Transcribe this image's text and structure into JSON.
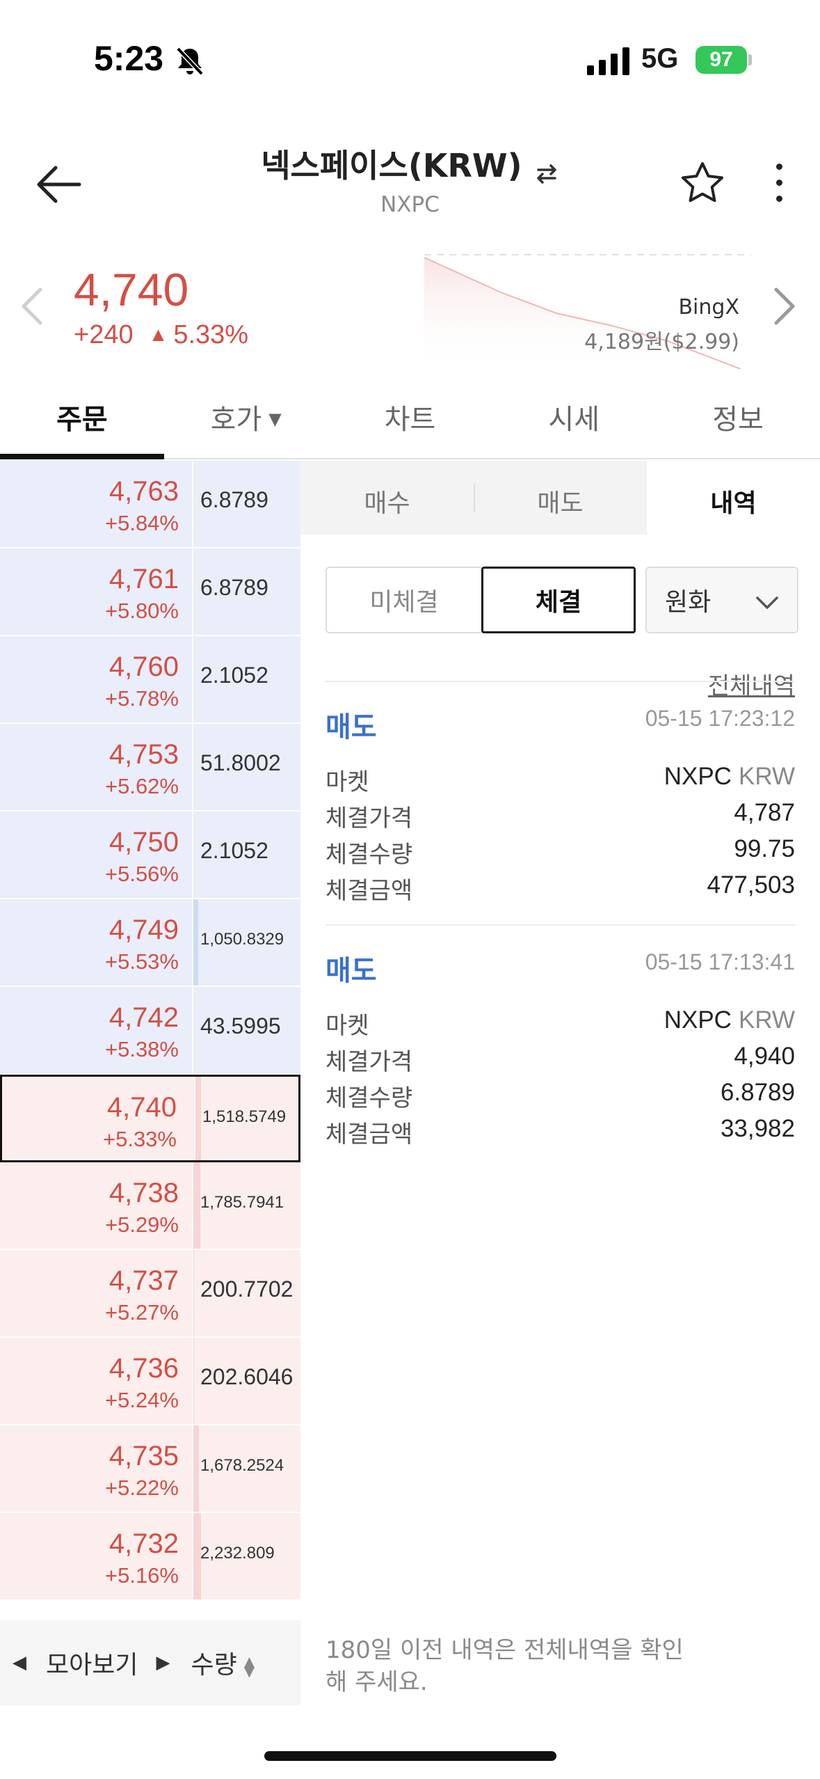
{
  "status_bar": {
    "time": "5:23",
    "network": "5G",
    "battery": "97"
  },
  "header": {
    "title": "넥스페이스(KRW)",
    "symbol": "NXPC"
  },
  "price": {
    "current": "4,740",
    "change_abs": "+240",
    "change_pct": "5.33%",
    "direction_icon": "▲",
    "exchange_name": "BingX",
    "exchange_price": "4,189원($2.99)"
  },
  "tabs": [
    {
      "label": "주문"
    },
    {
      "label": "호가"
    },
    {
      "label": "차트"
    },
    {
      "label": "시세"
    },
    {
      "label": "정보"
    }
  ],
  "order_book": {
    "rows": [
      {
        "price": "4,763",
        "rate": "+5.84%",
        "qty": "6.8789",
        "side": "ask",
        "depth": 0
      },
      {
        "price": "4,761",
        "rate": "+5.80%",
        "qty": "6.8789",
        "side": "ask",
        "depth": 0
      },
      {
        "price": "4,760",
        "rate": "+5.78%",
        "qty": "2.1052",
        "side": "ask",
        "depth": 0
      },
      {
        "price": "4,753",
        "rate": "+5.62%",
        "qty": "51.8002",
        "side": "ask",
        "depth": 0
      },
      {
        "price": "4,750",
        "rate": "+5.56%",
        "qty": "2.1052",
        "side": "ask",
        "depth": 0
      },
      {
        "price": "4,749",
        "rate": "+5.53%",
        "qty": "1,050.8329",
        "side": "ask",
        "depth": 0.05
      },
      {
        "price": "4,742",
        "rate": "+5.38%",
        "qty": "43.5995",
        "side": "ask",
        "depth": 0
      },
      {
        "price": "4,740",
        "rate": "+5.33%",
        "qty": "1,518.5749",
        "side": "bid",
        "depth": 0.06,
        "current": true
      },
      {
        "price": "4,738",
        "rate": "+5.29%",
        "qty": "1,785.7941",
        "side": "bid",
        "depth": 0.07
      },
      {
        "price": "4,737",
        "rate": "+5.27%",
        "qty": "200.7702",
        "side": "bid",
        "depth": 0.01
      },
      {
        "price": "4,736",
        "rate": "+5.24%",
        "qty": "202.6046",
        "side": "bid",
        "depth": 0.01
      },
      {
        "price": "4,735",
        "rate": "+5.22%",
        "qty": "1,678.2524",
        "side": "bid",
        "depth": 0.06
      },
      {
        "price": "4,732",
        "rate": "+5.16%",
        "qty": "2,232.809",
        "side": "bid",
        "depth": 0.08
      }
    ],
    "footer_group_label": "모아보기",
    "footer_sort_label": "수량"
  },
  "order_panel": {
    "tabs": [
      {
        "label": "매수"
      },
      {
        "label": "매도"
      },
      {
        "label": "내역"
      }
    ],
    "filter_pending": "미체결",
    "filter_done": "체결",
    "currency": "원화",
    "all_history": "전체내역",
    "field_labels": {
      "market": "마켓",
      "price": "체결가격",
      "qty": "체결수량",
      "amount": "체결금액"
    },
    "trades": [
      {
        "side": "매도",
        "time": "05-15 17:23:12",
        "market_base": "NXPC",
        "market_quote": "KRW",
        "price": "4,787",
        "qty": "99.75",
        "amount": "477,503"
      },
      {
        "side": "매도",
        "time": "05-15 17:13:41",
        "market_base": "NXPC",
        "market_quote": "KRW",
        "price": "4,940",
        "qty": "6.8789",
        "amount": "33,982"
      }
    ],
    "notice": "180일 이전 내역은 전체내역을 확인해 주세요."
  },
  "colors": {
    "up": "#d24f45",
    "sell": "#3a6fd0",
    "ask_bg": "#e9eefa",
    "bid_bg": "#fdeeee"
  }
}
